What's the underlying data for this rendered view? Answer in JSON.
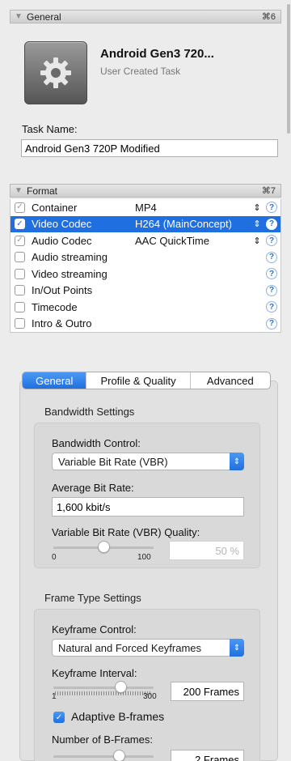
{
  "general_section": {
    "title": "General",
    "shortcut": "⌘6",
    "task_title": "Android Gen3 720...",
    "task_subtitle": "User Created Task",
    "task_name_label": "Task Name:",
    "task_name_value": "Android Gen3 720P Modified",
    "icon": "gear-icon"
  },
  "format_section": {
    "title": "Format",
    "shortcut": "⌘7",
    "rows": [
      {
        "label": "Container",
        "value": "MP4",
        "checked": true,
        "selected": false,
        "has_popup": true
      },
      {
        "label": "Video Codec",
        "value": "H264 (MainConcept)",
        "checked": true,
        "selected": true,
        "has_popup": true
      },
      {
        "label": "Audio Codec",
        "value": "AAC QuickTime",
        "checked": true,
        "selected": false,
        "has_popup": true
      },
      {
        "label": "Audio streaming",
        "value": "",
        "checked": false,
        "selected": false,
        "has_popup": false
      },
      {
        "label": "Video streaming",
        "value": "",
        "checked": false,
        "selected": false,
        "has_popup": false
      },
      {
        "label": "In/Out Points",
        "value": "",
        "checked": false,
        "selected": false,
        "has_popup": false
      },
      {
        "label": "Timecode",
        "value": "",
        "checked": false,
        "selected": false,
        "has_popup": false
      },
      {
        "label": "Intro & Outro",
        "value": "",
        "checked": false,
        "selected": false,
        "has_popup": false
      }
    ],
    "help_glyph": "?",
    "popup_glyph": "⇕"
  },
  "tabs": [
    {
      "label": "General",
      "active": true
    },
    {
      "label": "Profile & Quality",
      "active": false
    },
    {
      "label": "Advanced",
      "active": false
    }
  ],
  "bandwidth": {
    "group_title": "Bandwidth Settings",
    "control_label": "Bandwidth Control:",
    "control_value": "Variable Bit Rate (VBR)",
    "avg_label": "Average Bit Rate:",
    "avg_value": "1,600 kbit/s",
    "quality_label": "Variable Bit Rate (VBR) Quality:",
    "slider_min": "0",
    "slider_max": "100",
    "slider_level": 0.5,
    "quality_value": "50 %"
  },
  "frame_type": {
    "group_title": "Frame Type Settings",
    "keyframe_control_label": "Keyframe Control:",
    "keyframe_control_value": "Natural and Forced Keyframes",
    "keyframe_interval_label": "Keyframe Interval:",
    "interval_min": "1",
    "interval_max": "300",
    "interval_level": 0.67,
    "interval_value": "200 Frames",
    "adaptive_label": "Adaptive B-frames",
    "adaptive_checked": true,
    "bframes_label": "Number of B-Frames:",
    "bframes_value": "2 Frames"
  },
  "colors": {
    "accent": "#1f6fe0"
  }
}
